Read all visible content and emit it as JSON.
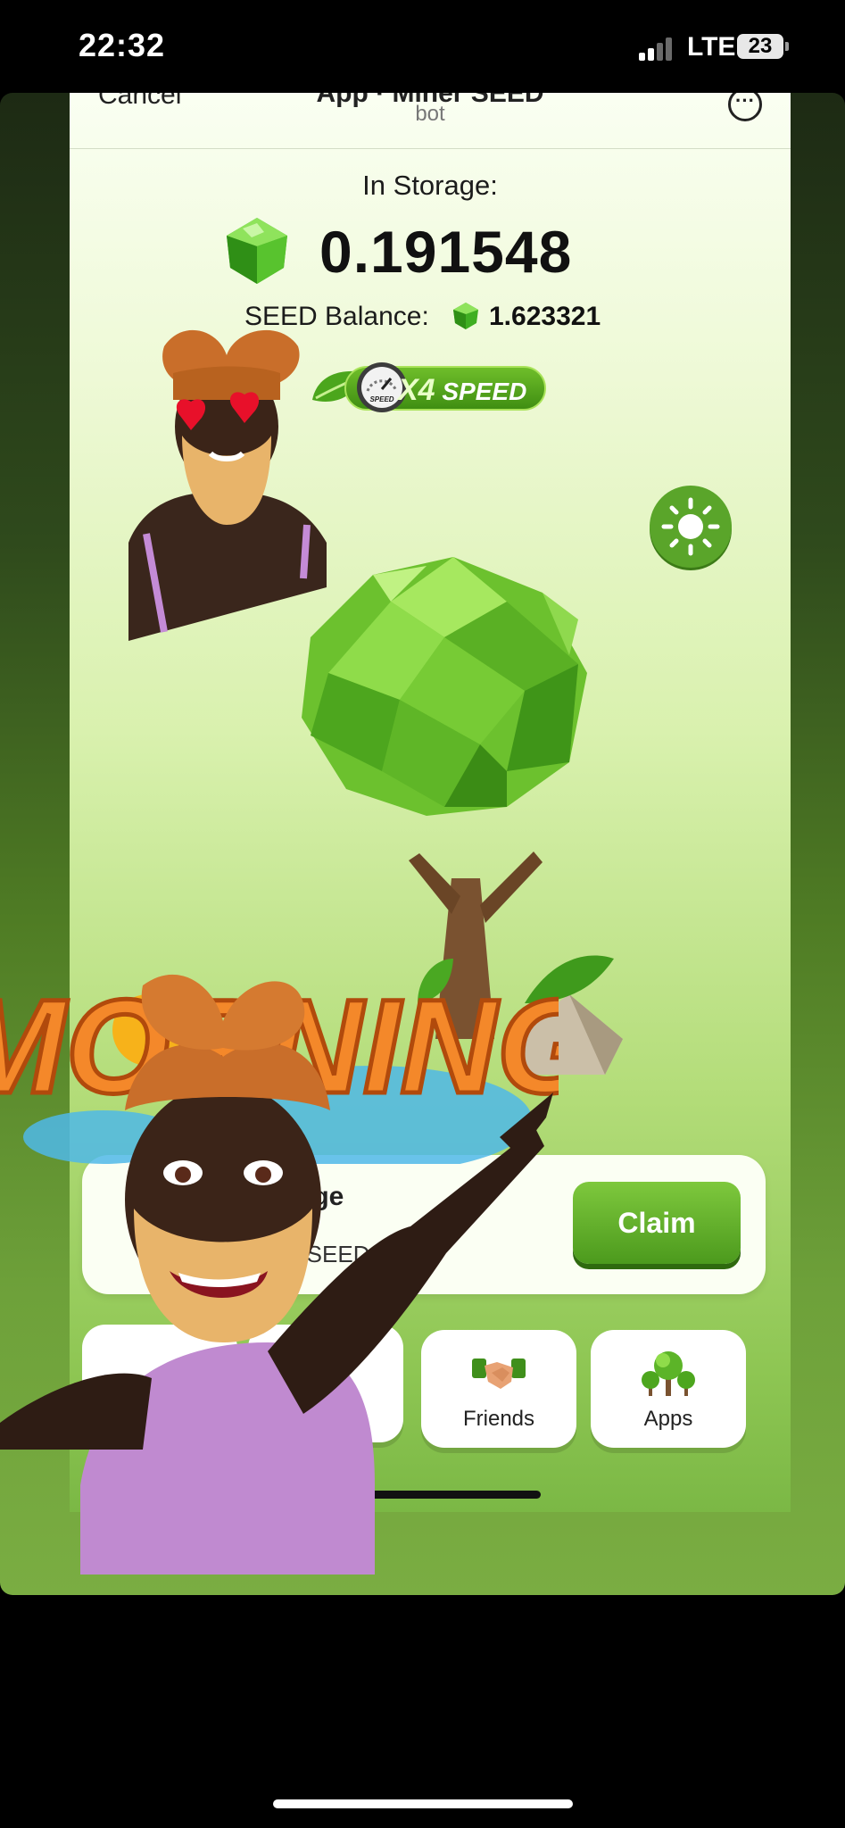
{
  "status_bar": {
    "time": "22:32",
    "network": "LTE",
    "battery": "23"
  },
  "header": {
    "cancel_label": "Cancel",
    "title": "App · Miner SEED",
    "subtitle": "bot",
    "more_icon": "ellipsis-icon"
  },
  "main": {
    "storage_label": "In Storage:",
    "storage_value": "0.191548",
    "balance_label": "SEED Balance:",
    "balance_value": "1.623321",
    "speed_multiplier": "X4",
    "speed_label": "SPEED",
    "speedometer_text": "SPEED"
  },
  "storage_card": {
    "title_visible": "rage",
    "rate_visible": "3 SEED/h",
    "claim_label": "Claim"
  },
  "nav": {
    "friends_label": "Friends",
    "apps_label": "Apps"
  },
  "overlay": {
    "sticker_text": "MORNING"
  },
  "colors": {
    "accent": "#5aa52a",
    "claim": "#4c9a1d",
    "background_top": "#fafff2",
    "background_bottom": "#7bb845"
  }
}
